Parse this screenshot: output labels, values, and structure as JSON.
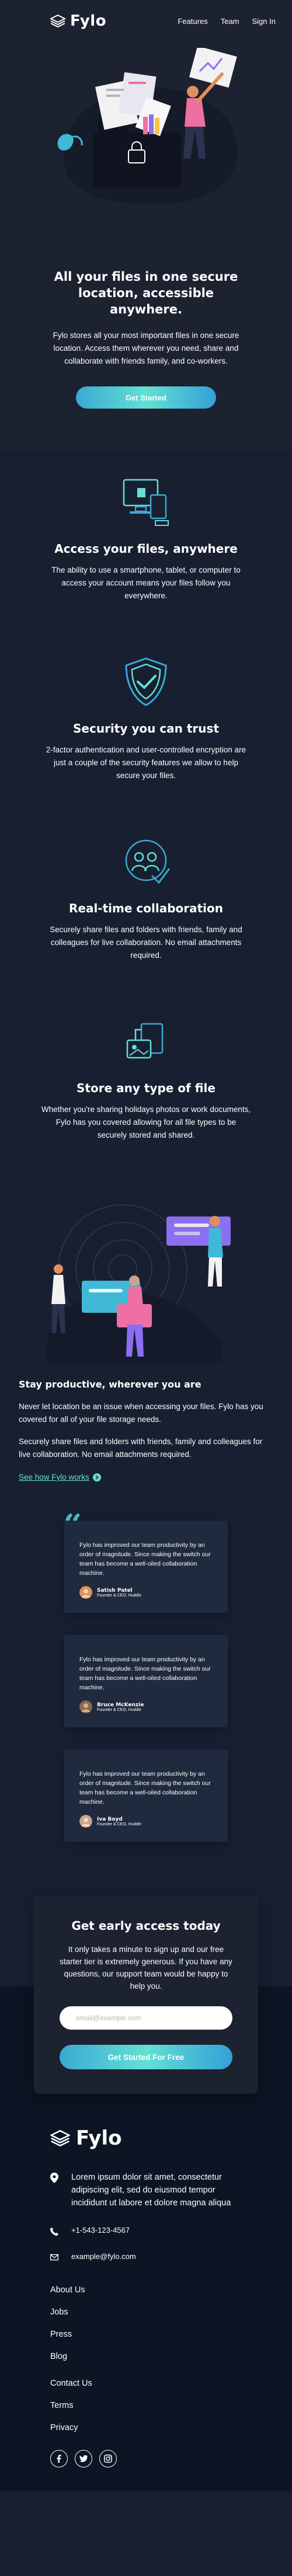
{
  "header": {
    "logo": "Fylo",
    "nav": [
      "Features",
      "Team",
      "Sign In"
    ]
  },
  "hero": {
    "title": "All your files in one secure location, accessible anywhere.",
    "description": "Fylo stores all your most important files in one secure location. Access them wherever you need, share and collaborate with friends family, and co-workers.",
    "cta": "Get Started"
  },
  "features": [
    {
      "icon": "devices-icon",
      "title": "Access your files, anywhere",
      "description": "The ability to use a smartphone, tablet, or computer to access your account means your files follow you everywhere."
    },
    {
      "icon": "shield-check-icon",
      "title": "Security you can trust",
      "description": "2-factor authentication and user-controlled encryption are just a couple of the security features we allow to help secure your files."
    },
    {
      "icon": "collaboration-icon",
      "title": "Real-time collaboration",
      "description": "Securely share files and folders with friends, family and colleagues for live collaboration. No email attachments required."
    },
    {
      "icon": "files-icon",
      "title": "Store any type of file",
      "description": "Whether you're sharing holidays photos or work documents, Fylo has you covered allowing for all file types to be securely stored and shared."
    }
  ],
  "productive": {
    "title": "Stay productive, wherever you are",
    "p1": "Never let location be an issue when accessing your files. Fylo has you covered for all of your file storage needs.",
    "p2": "Securely share files and folders with friends, family and colleagues for live collaboration. No email attachments required.",
    "link": "See how Fylo works"
  },
  "testimonials": [
    {
      "text": "Fylo has improved our team productivity by an order of magnitude. Since making the switch our team has become a well-oiled collaboration machine.",
      "name": "Satish Patel",
      "role": "Founder & CEO, Huddle",
      "avatar_color": "#e0915a"
    },
    {
      "text": "Fylo has improved our team productivity by an order of magnitude. Since making the switch our team has become a well-oiled collaboration machine.",
      "name": "Bruce McKenzie",
      "role": "Founder & CEO, Huddle",
      "avatar_color": "#8a6a4c"
    },
    {
      "text": "Fylo has improved our team productivity by an order of magnitude. Since making the switch our team has become a well-oiled collaboration machine.",
      "name": "Iva Boyd",
      "role": "Founder & CEO, Huddle",
      "avatar_color": "#c9a48a"
    }
  ],
  "cta": {
    "title": "Get early access today",
    "description": "It only takes a minute to sign up and our free starter tier is extremely generous. If you have any questions, our support team would be happy to help you.",
    "placeholder": "email@example.com",
    "button": "Get Started For Free"
  },
  "footer": {
    "logo": "Fylo",
    "address": "Lorem ipsum dolor sit amet, consectetur adipiscing elit, sed do eiusmod tempor incididunt ut labore et dolore magna aliqua",
    "phone": "+1-543-123-4567",
    "email": "example@fylo.com",
    "links1": [
      "About Us",
      "Jobs",
      "Press",
      "Blog"
    ],
    "links2": [
      "Contact Us",
      "Terms",
      "Privacy"
    ]
  },
  "colors": {
    "bg_dark": "#181f31",
    "bg_intro": "#1c2230",
    "footer": "#0c1524",
    "accent": "#62e0d4",
    "accent_blue": "#3ba9d2"
  }
}
